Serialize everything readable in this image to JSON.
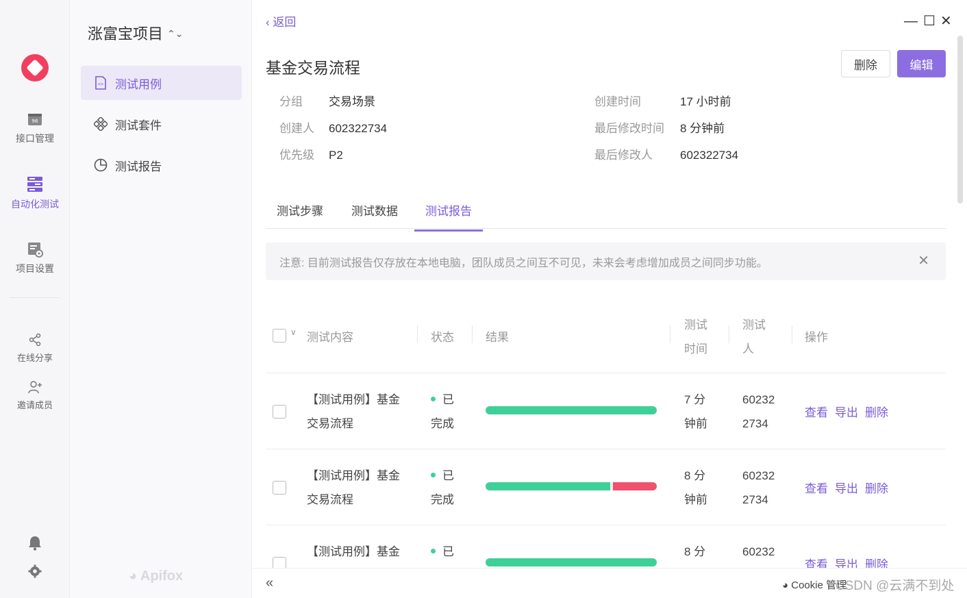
{
  "rail": {
    "items": [
      {
        "label": "接口管理",
        "icon": "api-icon"
      },
      {
        "label": "自动化测试",
        "icon": "automation-icon",
        "active": true
      },
      {
        "label": "项目设置",
        "icon": "settings-doc-icon"
      },
      {
        "label": "在线分享",
        "icon": "share-icon"
      },
      {
        "label": "邀请成员",
        "icon": "invite-icon"
      }
    ]
  },
  "sidebar": {
    "project_title": "涨富宝项目",
    "items": [
      {
        "label": "测试用例",
        "active": true
      },
      {
        "label": "测试套件"
      },
      {
        "label": "测试报告"
      }
    ],
    "brand": "Apifox"
  },
  "header": {
    "back": "返回",
    "title": "基金交易流程",
    "delete_label": "删除",
    "edit_label": "编辑"
  },
  "meta": {
    "group_k": "分组",
    "group_v": "交易场景",
    "creator_k": "创建人",
    "creator_v": "602322734",
    "priority_k": "优先级",
    "priority_v": "P2",
    "created_k": "创建时间",
    "created_v": "17 小时前",
    "modified_k": "最后修改时间",
    "modified_v": "8 分钟前",
    "modifier_k": "最后修改人",
    "modifier_v": "602322734"
  },
  "tabs": [
    {
      "label": "测试步骤"
    },
    {
      "label": "测试数据"
    },
    {
      "label": "测试报告",
      "active": true
    }
  ],
  "notice": "注意: 目前测试报告仅存放在本地电脑，团队成员之间互不可见，未来会考虑增加成员之间同步功能。",
  "table": {
    "headers": {
      "content": "测试内容",
      "status": "状态",
      "result": "结果",
      "time_1": "测试",
      "time_2": "时间",
      "user_1": "测试",
      "user_2": "人",
      "ops": "操作"
    },
    "rows": [
      {
        "content_1": "【测试用例】基金",
        "content_2": "交易流程",
        "status_1": "已",
        "status_2": "完成",
        "pass_fraction": 1.0,
        "time_1": "7 分",
        "time_2": "钟前",
        "user_1": "60232",
        "user_2": "2734",
        "ops": [
          "查看",
          "导出",
          "删除"
        ]
      },
      {
        "content_1": "【测试用例】基金",
        "content_2": "交易流程",
        "status_1": "已",
        "status_2": "完成",
        "pass_fraction": 0.74,
        "time_1": "8 分",
        "time_2": "钟前",
        "user_1": "60232",
        "user_2": "2734",
        "ops": [
          "查看",
          "导出",
          "删除"
        ]
      },
      {
        "content_1": "【测试用例】基金",
        "content_2": "",
        "status_1": "已",
        "status_2": "",
        "pass_fraction": 1.0,
        "time_1": "8 分",
        "time_2": "",
        "user_1": "60232",
        "user_2": "",
        "ops": [
          "查看",
          "导出",
          "删除"
        ]
      }
    ]
  },
  "footer": {
    "cookie": "Cookie 管理",
    "watermark": "CSDN @云满不到处"
  },
  "colors": {
    "accent": "#8c6ee0",
    "pass": "#3fd09a",
    "fail": "#f0516e"
  }
}
